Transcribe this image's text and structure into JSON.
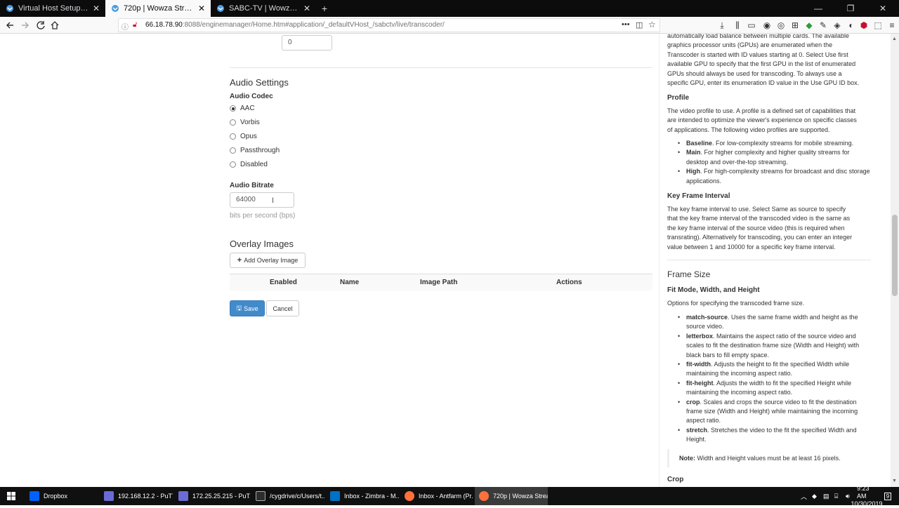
{
  "browser": {
    "tabs": [
      {
        "label": "Virtual Host Setup | Wowza Str",
        "active": false
      },
      {
        "label": "720p | Wowza Streaming Engin",
        "active": true
      },
      {
        "label": "SABC-TV | Wowza Streaming E",
        "active": false
      }
    ],
    "new_tab_symbol": "+",
    "url_host": "66.18.78.90",
    "url_rest": ":8088/enginemanager/Home.htm#application/_defaultVHost_/sabctv/live/transcoder/"
  },
  "form": {
    "top_input_value": "0",
    "audio_settings_title": "Audio Settings",
    "audio_codec_label": "Audio Codec",
    "audio_codec_options": [
      "AAC",
      "Vorbis",
      "Opus",
      "Passthrough",
      "Disabled"
    ],
    "audio_codec_selected": "AAC",
    "audio_bitrate_label": "Audio Bitrate",
    "audio_bitrate_value": "64000",
    "audio_bitrate_help": "bits per second (bps)",
    "overlay_images_title": "Overlay Images",
    "add_overlay_label": "Add Overlay Image",
    "table_headers": [
      "Enabled",
      "Name",
      "Image Path",
      "Actions"
    ],
    "save_label": "Save",
    "cancel_label": "Cancel"
  },
  "help": {
    "intro_lines": [
      "automatically load balance between multiple cards. The available",
      "graphics processor units (GPUs) are enumerated when the",
      "Transcoder is started with ID values starting at 0. Select Use first",
      "available GPU to specify that the first GPU in the list of enumerated",
      "GPUs should always be used for transcoding. To always use a",
      "specific GPU, enter its enumeration ID value in the Use GPU ID box."
    ],
    "profile_heading": "Profile",
    "profile_lines": [
      "The video profile to use. A profile is a defined set of capabilities that",
      "are intended to optimize the viewer's experience on specific classes",
      "of applications. The following video profiles are supported."
    ],
    "profile_items": [
      {
        "term": "Baseline",
        "text": ". For low-complexity streams for mobile streaming."
      },
      {
        "term": "Main",
        "text": ". For higher complexity and higher quality streams for desktop and over-the-top streaming."
      },
      {
        "term": "High",
        "text": ". For high-complexity streams for broadcast and disc storage applications."
      }
    ],
    "keyframe_heading": "Key Frame Interval",
    "keyframe_lines": [
      "The key frame interval to use. Select Same as source to specify",
      "that the key frame interval of the transcoded video is the same as",
      "the key frame interval of the source video (this is required when",
      "transrating). Alternatively for transcoding, you can enter an integer",
      "value between 1 and 10000 for a specific key frame interval."
    ],
    "frame_size_title": "Frame Size",
    "fit_heading": "Fit Mode, Width, and Height",
    "fit_intro": "Options for specifying the transcoded frame size.",
    "fit_items": [
      {
        "term": "match-source",
        "text": ". Uses the same frame width and height as the source video."
      },
      {
        "term": "letterbox",
        "text": ". Maintains the aspect ratio of the source video and scales to fit the destination frame size (Width and Height) with black bars to fill empty space."
      },
      {
        "term": "fit-width",
        "text": ". Adjusts the height to fit the specified Width while maintaining the incoming aspect ratio."
      },
      {
        "term": "fit-height",
        "text": ". Adjusts the width to fit the specified Height while maintaining the incoming aspect ratio."
      },
      {
        "term": "crop",
        "text": ". Scales and crops the source video to fit the destination frame size (Width and Height) while maintaining the incoming aspect ratio."
      },
      {
        "term": "stretch",
        "text": ". Stretches the video to the fit the specified Width and Height."
      }
    ],
    "note_label": "Note:",
    "note_text": "Width and Height values must be at least 16 pixels.",
    "crop_heading": "Crop"
  },
  "taskbar": {
    "items": [
      {
        "label": "Dropbox",
        "active": false
      },
      {
        "label": "192.168.12.2 - PuTTY",
        "active": false
      },
      {
        "label": "172.25.25.215 - PuT...",
        "active": false
      },
      {
        "label": "/cygdrive/c/Users/t...",
        "active": false
      },
      {
        "label": "Inbox - Zimbra - M...",
        "active": false
      },
      {
        "label": "Inbox - Antfarm (Pr...",
        "active": false
      },
      {
        "label": "720p | Wowza Strea...",
        "active": true
      }
    ],
    "time": "9:23 AM",
    "date": "10/30/2019",
    "notification_count": "9"
  }
}
